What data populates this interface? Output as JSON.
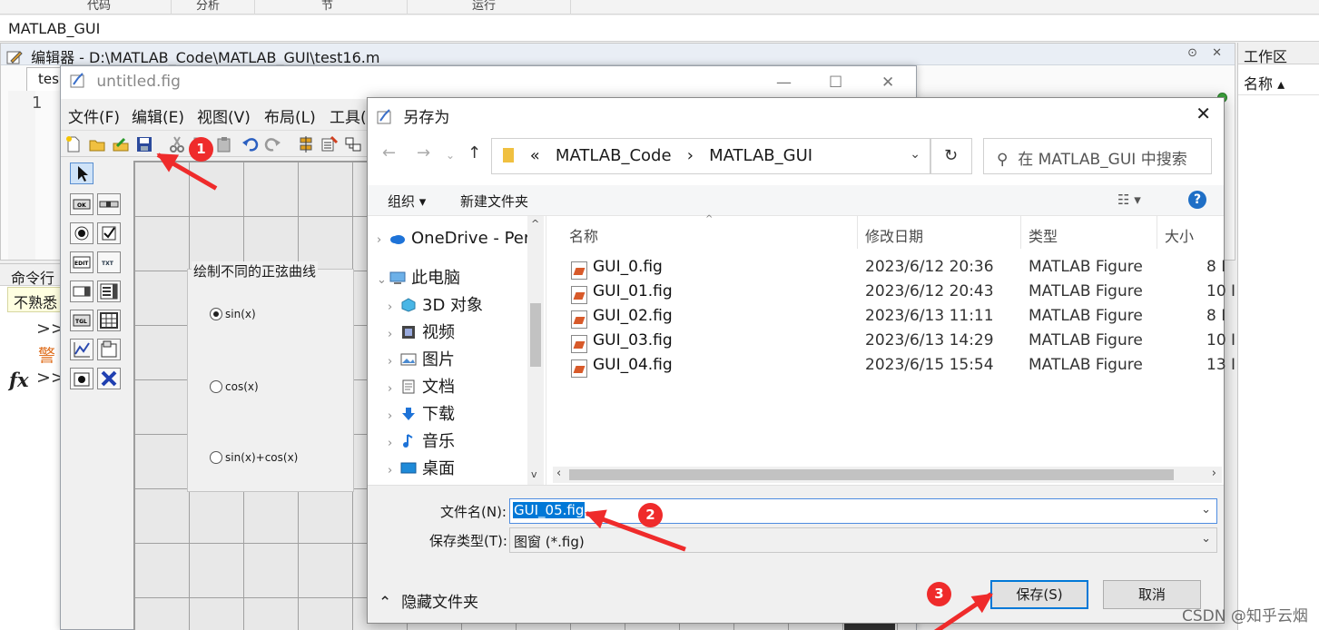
{
  "ribbon": {
    "tabs": [
      "代码",
      "分析",
      "节",
      "运行"
    ]
  },
  "address": {
    "path": "MATLAB_GUI"
  },
  "editor": {
    "title": "编辑器 - D:\\MATLAB_Code\\MATLAB_GUI\\test16.m",
    "tab_label": "tes",
    "line_number": "1",
    "window_buttons": "⊙ ✕"
  },
  "workspace": {
    "title": "工作区",
    "column": "名称 ▴"
  },
  "command_window": {
    "title": "命令行",
    "warning": "不熟悉",
    "prompt": ">>",
    "warn_char": "警",
    "fx": "fx"
  },
  "guide": {
    "title": "untitled.fig",
    "controls": {
      "minimize": "—",
      "maximize": "☐",
      "close": "✕"
    },
    "menu": [
      "文件(F)",
      "编辑(E)",
      "视图(V)",
      "布局(L)",
      "工具("
    ],
    "button_group": {
      "title": "绘制不同的正弦曲线",
      "options": [
        {
          "label": "sin(x)",
          "checked": true
        },
        {
          "label": "cos(x)",
          "checked": false
        },
        {
          "label": "sin(x)+cos(x)",
          "checked": false
        }
      ]
    }
  },
  "dialog": {
    "title": "另存为",
    "close": "✕",
    "path": {
      "prefix": "«",
      "segments": [
        "MATLAB_Code",
        "›",
        "MATLAB_GUI"
      ]
    },
    "search_placeholder": "在 MATLAB_GUI 中搜索",
    "toolbar": {
      "organize": "组织 ▾",
      "new_folder": "新建文件夹",
      "view": "☷ ▾",
      "help": "?"
    },
    "tree": [
      {
        "label": "OneDrive - Per",
        "icon": "cloud-icon",
        "indent": 0
      },
      {
        "label": "此电脑",
        "icon": "computer-icon",
        "indent": 0,
        "expanded": true
      },
      {
        "label": "3D 对象",
        "icon": "cube-icon",
        "indent": 1
      },
      {
        "label": "视频",
        "icon": "video-icon",
        "indent": 1
      },
      {
        "label": "图片",
        "icon": "picture-icon",
        "indent": 1
      },
      {
        "label": "文档",
        "icon": "document-icon",
        "indent": 1
      },
      {
        "label": "下载",
        "icon": "download-icon",
        "indent": 1
      },
      {
        "label": "音乐",
        "icon": "music-icon",
        "indent": 1
      },
      {
        "label": "桌面",
        "icon": "desktop-icon",
        "indent": 1
      }
    ],
    "columns": [
      "名称",
      "修改日期",
      "类型",
      "大小"
    ],
    "files": [
      {
        "name": "GUI_0.fig",
        "date": "2023/6/12 20:36",
        "type": "MATLAB Figure",
        "size": "8 I"
      },
      {
        "name": "GUI_01.fig",
        "date": "2023/6/12 20:43",
        "type": "MATLAB Figure",
        "size": "10 I"
      },
      {
        "name": "GUI_02.fig",
        "date": "2023/6/13 11:11",
        "type": "MATLAB Figure",
        "size": "8 I"
      },
      {
        "name": "GUI_03.fig",
        "date": "2023/6/13 14:29",
        "type": "MATLAB Figure",
        "size": "10 I"
      },
      {
        "name": "GUI_04.fig",
        "date": "2023/6/15 15:54",
        "type": "MATLAB Figure",
        "size": "13 I"
      }
    ],
    "filename_label": "文件名(N):",
    "filename_value": "GUI_05.fig",
    "filetype_label": "保存类型(T):",
    "filetype_value": "图窗 (*.fig)",
    "hide_folders": "隐藏文件夹",
    "save": "保存(S)",
    "cancel": "取消"
  },
  "annotations": {
    "step1": "1",
    "step2": "2",
    "step3": "3",
    "color": "#ef2b2b"
  },
  "watermark": "CSDN @知乎云烟"
}
